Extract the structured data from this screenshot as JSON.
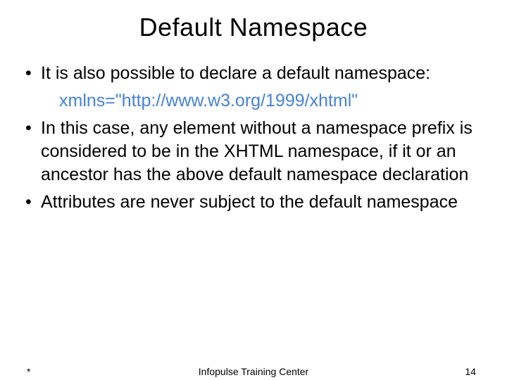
{
  "title": "Default Namespace",
  "bullets": {
    "b1": "It is also possible to declare a default namespace:",
    "b1_sub": "xmlns=\"http://www.w3.org/1999/xhtml\"",
    "b2": "In this case, any element without a namespace prefix is considered to be in the XHTML namespace, if it or an ancestor has the above default namespace declaration",
    "b3": "Attributes are never subject to the default namespace"
  },
  "footer": {
    "left": "*",
    "center": "Infopulse Training Center",
    "page": "14"
  }
}
